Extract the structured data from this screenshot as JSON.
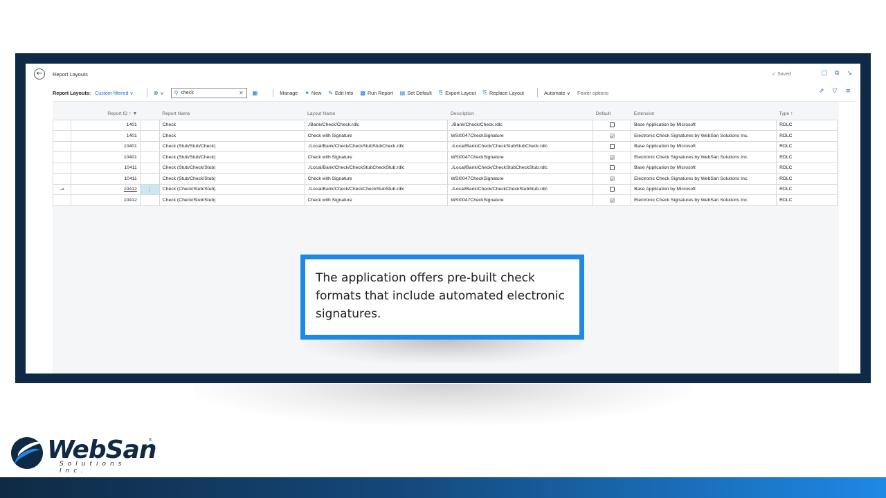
{
  "header": {
    "title": "Report Layouts",
    "saved_label": "✓ Saved"
  },
  "actionbar": {
    "title": "Report Layouts:",
    "filter": "Custom filtered ∨",
    "search_value": "check",
    "manage": "Manage",
    "new": "New",
    "edit_info": "Edit Info",
    "run_report": "Run Report",
    "set_default": "Set Default",
    "export_layout": "Export Layout",
    "replace_layout": "Replace Layout",
    "automate": "Automate ∨",
    "fewer_options": "Fewer options"
  },
  "table": {
    "headers": {
      "report_id": "Report ID ↑ ▼",
      "report_name": "Report Name",
      "layout_name": "Layout Name",
      "description": "Description",
      "default": "Default",
      "extension": "Extension",
      "type": "Type ↑"
    },
    "rows": [
      {
        "report_id": "1401",
        "report_name": "Check",
        "layout_name": "./Bank/Check/Check.rdlc",
        "description": "./Bank/Check/Check.rdlc",
        "default": false,
        "extension": "Base Application by Microsoft",
        "type": "RDLC"
      },
      {
        "report_id": "1401",
        "report_name": "Check",
        "layout_name": "Check with Signature",
        "description": "WSI0047CheckSignature",
        "default": true,
        "extension": "Electronic Check Signatures by WebSan Solutions Inc.",
        "type": "RDLC"
      },
      {
        "report_id": "10401",
        "report_name": "Check (Stub/Stub/Check)",
        "layout_name": "./Local/Bank/Check/CheckStubStubCheck.rdlc",
        "description": "./Local/Bank/Check/CheckStubStubCheck.rdlc",
        "default": false,
        "extension": "Base Application by Microsoft",
        "type": "RDLC"
      },
      {
        "report_id": "10401",
        "report_name": "Check (Stub/Stub/Check)",
        "layout_name": "Check with Signature",
        "description": "WSI0047CheckSignature",
        "default": true,
        "extension": "Electronic Check Signatures by WebSan Solutions Inc.",
        "type": "RDLC"
      },
      {
        "report_id": "10411",
        "report_name": "Check (Stub/Check/Stub)",
        "layout_name": "./Local/Bank/Check/CheckStubCheckStub.rdlc",
        "description": "./Local/Bank/Check/CheckStubCheckStub.rdlc",
        "default": false,
        "extension": "Base Application by Microsoft",
        "type": "RDLC"
      },
      {
        "report_id": "10411",
        "report_name": "Check (Stub/Check/Stub)",
        "layout_name": "Check with Signature",
        "description": "WSI0047CheckSignature",
        "default": true,
        "extension": "Electronic Check Signatures by WebSan Solutions Inc.",
        "type": "RDLC"
      },
      {
        "report_id": "10412",
        "report_name": "Check (Check/Stub/Stub)",
        "layout_name": "./Local/Bank/Check/CheckCheckStubStub.rdlc",
        "description": "./Local/Bank/Check/CheckCheckStubStub.rdlc",
        "default": false,
        "extension": "Base Application by Microsoft",
        "type": "RDLC"
      },
      {
        "report_id": "10412",
        "report_name": "Check (Check/Stub/Stub)",
        "layout_name": "Check with Signature",
        "description": "WSI0047CheckSignature",
        "default": true,
        "extension": "Electronic Check Signatures by WebSan Solutions Inc.",
        "type": "RDLC"
      }
    ],
    "selected_row": 6
  },
  "callout": {
    "text": "The application offers pre-built check formats that include automated electronic signatures."
  },
  "logo": {
    "name": "WebSan",
    "subtitle": "Solutions Inc.",
    "reg": "®"
  },
  "colors": {
    "frame": "#0f2a44",
    "accent": "#1e88e5",
    "link": "#1f6fd0"
  }
}
